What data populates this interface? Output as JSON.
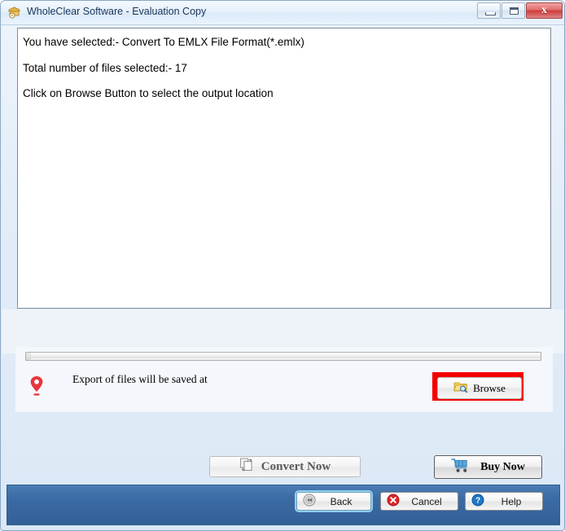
{
  "window": {
    "title": "WholeClear Software - Evaluation Copy",
    "icon": "app-box-icon",
    "controls": {
      "minimize": "minimize-button",
      "maximize": "maximize-button",
      "close": "close-button",
      "close_glyph": "x"
    }
  },
  "content": {
    "lines": [
      "You have selected:- Convert To EMLX File Format(*.emlx)",
      "Total number of files selected:-  17",
      "Click on Browse Button to select the output location"
    ]
  },
  "output": {
    "pin_icon": "location-pin-icon",
    "label": "Export of files will be saved at",
    "browse_label": "Browse",
    "browse_icon": "folder-search-icon",
    "highlight_color": "#f40000",
    "progress_value": 0
  },
  "actions": {
    "convert_label": "Convert Now",
    "convert_icon": "convert-documents-icon",
    "convert_disabled": true,
    "buy_label": "Buy Now",
    "buy_icon": "shopping-cart-icon"
  },
  "footer": {
    "back_label": "Back",
    "back_icon": "rewind-icon",
    "cancel_label": "Cancel",
    "cancel_icon": "cancel-circle-icon",
    "help_label": "Help",
    "help_icon": "help-circle-icon",
    "bar_color": "#3b6ba4"
  }
}
